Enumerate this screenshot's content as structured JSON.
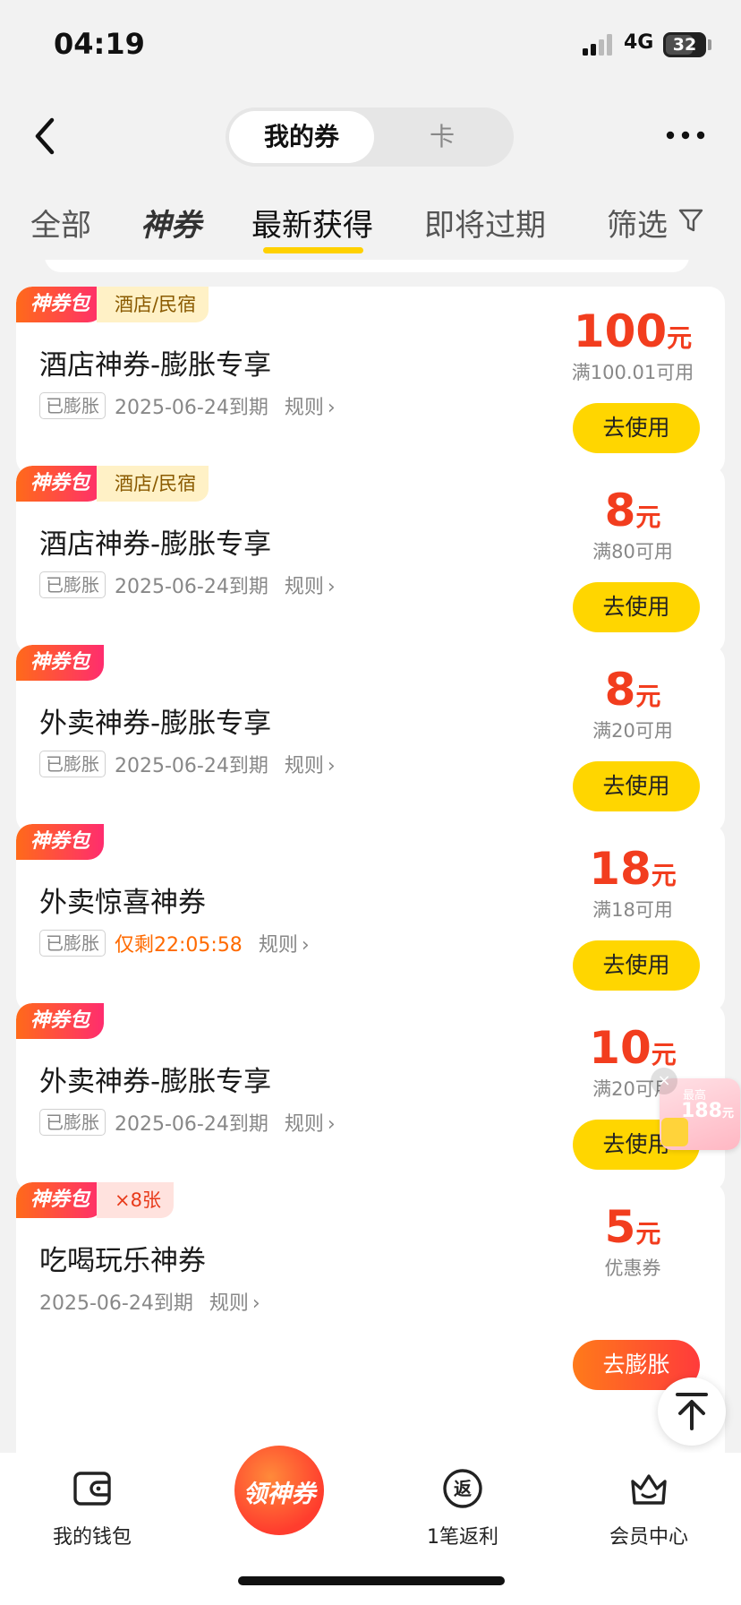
{
  "status_bar": {
    "time": "04:19",
    "network": "4G",
    "battery": "32"
  },
  "header": {
    "segments": [
      {
        "label": "我的券",
        "active": true
      },
      {
        "label": "卡",
        "active": false
      }
    ]
  },
  "tabs": [
    {
      "label": "全部"
    },
    {
      "label": "神券"
    },
    {
      "label": "最新获得",
      "active": true
    },
    {
      "label": "即将过期"
    },
    {
      "label": "筛选"
    }
  ],
  "coupons": [
    {
      "pack_tag": "神券包",
      "category": "酒店/民宿",
      "title": "酒店神券-膨胀专享",
      "badge": "已膨胀",
      "expire": "2025-06-24到期",
      "rule": "规则",
      "amount": "100",
      "unit": "元",
      "condition": "满100.01可用",
      "button": "去使用"
    },
    {
      "pack_tag": "神券包",
      "category": "酒店/民宿",
      "title": "酒店神券-膨胀专享",
      "badge": "已膨胀",
      "expire": "2025-06-24到期",
      "rule": "规则",
      "amount": "8",
      "unit": "元",
      "condition": "满80可用",
      "button": "去使用"
    },
    {
      "pack_tag": "神券包",
      "title": "外卖神券-膨胀专享",
      "badge": "已膨胀",
      "expire": "2025-06-24到期",
      "rule": "规则",
      "amount": "8",
      "unit": "元",
      "condition": "满20可用",
      "button": "去使用"
    },
    {
      "pack_tag": "神券包",
      "title": "外卖惊喜神券",
      "badge": "已膨胀",
      "countdown": "仅剩22:05:58",
      "rule": "规则",
      "amount": "18",
      "unit": "元",
      "condition": "满18可用",
      "button": "去使用"
    },
    {
      "pack_tag": "神券包",
      "title": "外卖神券-膨胀专享",
      "badge": "已膨胀",
      "expire": "2025-06-24到期",
      "rule": "规则",
      "amount": "10",
      "unit": "元",
      "condition": "满20可用",
      "button": "去使用"
    },
    {
      "pack_tag": "神券包",
      "count": "×8张",
      "title": "吃喝玩乐神券",
      "expire": "2025-06-24到期",
      "rule": "规则",
      "amount": "5",
      "unit": "元",
      "condition": "优惠券",
      "button": "去膨胀"
    }
  ],
  "promo": {
    "top_text": "最高",
    "amount": "188",
    "unit": "元"
  },
  "bottom_nav": {
    "wallet": "我的钱包",
    "center": "领神券",
    "rebate": "1笔返利",
    "rebate_icon_text": "返",
    "member": "会员中心"
  },
  "colors": {
    "accent_yellow": "#ffd600",
    "price_red": "#f23d1e",
    "countdown_orange": "#ff6a00"
  }
}
